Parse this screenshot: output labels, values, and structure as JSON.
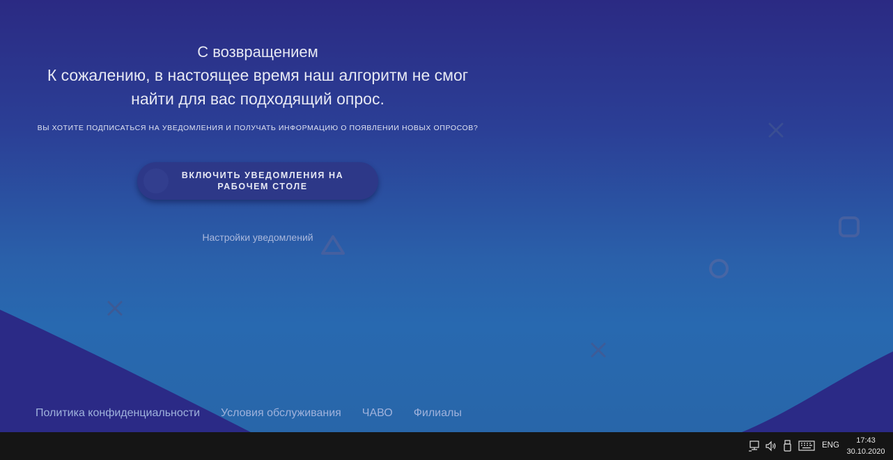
{
  "hero": {
    "welcome": "С возвращением",
    "sorry_line1": "К сожалению, в настоящее время наш алгоритм не смог",
    "sorry_line2": "найти для вас подходящий опрос.",
    "question": "ВЫ ХОТИТЕ ПОДПИСАТЬСЯ НА УВЕДОМЛЕНИЯ И ПОЛУЧАТЬ ИНФОРМАЦИЮ О ПОЯВЛЕНИИ НОВЫХ ОПРОСОВ?"
  },
  "enable_button": {
    "line1": "ВКЛЮЧИТЬ УВЕДОМЛЕНИЯ НА",
    "line2": "РАБОЧЕМ СТОЛЕ"
  },
  "settings_link": "Настройки уведомлений",
  "footer": {
    "links": [
      "Политика конфиденциальности",
      "Условия обслуживания",
      "ЧАВО",
      "Филиалы"
    ]
  },
  "background_shapes": [
    "cross-icon",
    "cross-icon",
    "cross-icon",
    "triangle-icon",
    "circle-icon",
    "square-icon"
  ],
  "taskbar": {
    "tray_icons": [
      "network-icon",
      "volume-icon",
      "usb-device-icon",
      "keyboard-icon"
    ],
    "language": "ENG",
    "time": "17:43",
    "date": "30.10.2020"
  },
  "colors": {
    "background_top": "#2b2a83",
    "background_bottom": "#2869b0",
    "wave": "#2b2a86",
    "button": "#2d3888",
    "text": "#e6e8f3",
    "link": "#9fb2dc",
    "taskbar": "#151515"
  }
}
